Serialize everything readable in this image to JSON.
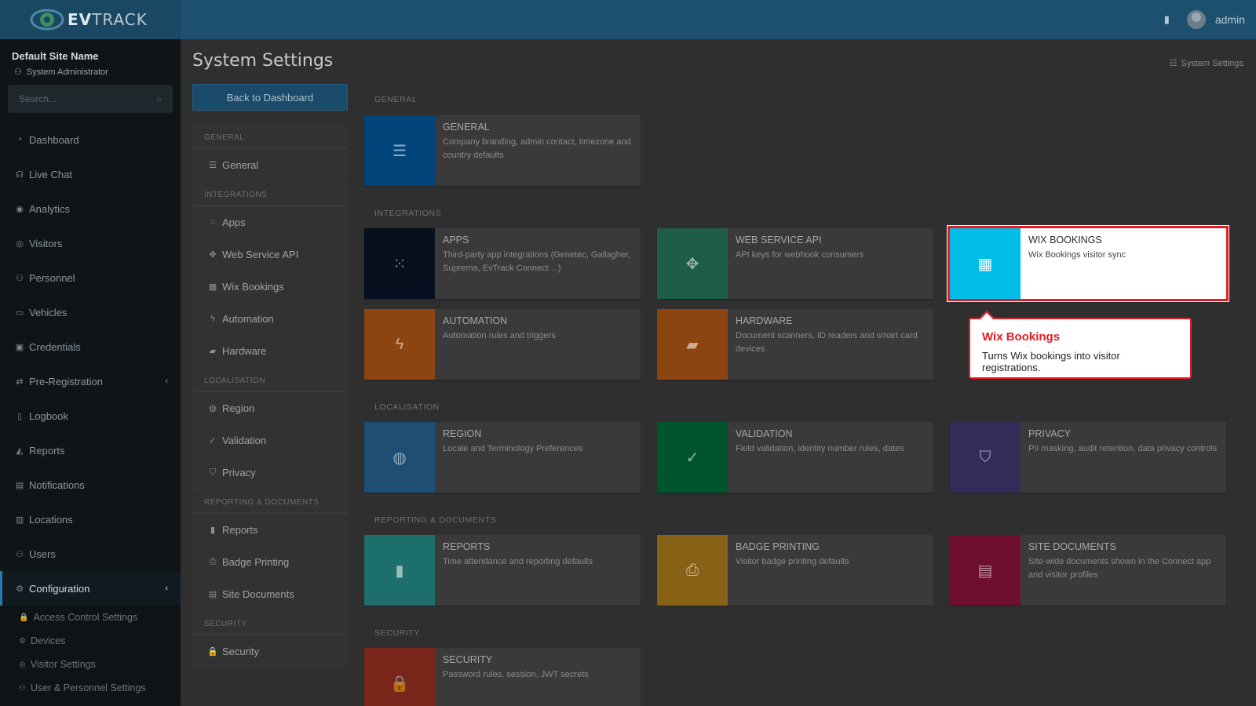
{
  "app": {
    "logo_bold": "EV",
    "logo_light": "TRACK",
    "user": "admin"
  },
  "sidebar": {
    "site_name": "Default Site Name",
    "role": "System Administrator",
    "search_placeholder": "Search...",
    "items": [
      {
        "label": "Dashboard",
        "icon": "dashboard-icon",
        "glyph": "◔"
      },
      {
        "label": "Live Chat",
        "icon": "headset-icon",
        "glyph": "☊"
      },
      {
        "label": "Analytics",
        "icon": "target-icon",
        "glyph": "◉"
      },
      {
        "label": "Visitors",
        "icon": "eye-icon",
        "glyph": "◎"
      },
      {
        "label": "Personnel",
        "icon": "users-icon",
        "glyph": "⚇"
      },
      {
        "label": "Vehicles",
        "icon": "car-icon",
        "glyph": "▭"
      },
      {
        "label": "Credentials",
        "icon": "id-card-icon",
        "glyph": "▣"
      },
      {
        "label": "Pre-Registration",
        "icon": "arrows-icon",
        "glyph": "⇄"
      },
      {
        "label": "Logbook",
        "icon": "book-icon",
        "glyph": "▯"
      },
      {
        "label": "Reports",
        "icon": "chart-icon",
        "glyph": "◭"
      },
      {
        "label": "Notifications",
        "icon": "chat-icon",
        "glyph": "▤"
      },
      {
        "label": "Locations",
        "icon": "map-icon",
        "glyph": "▥"
      },
      {
        "label": "Users",
        "icon": "user-group-icon",
        "glyph": "⚇"
      },
      {
        "label": "Configuration",
        "icon": "gear-icon",
        "glyph": "⚙"
      }
    ],
    "sub_items": [
      {
        "label": "Access Control Settings",
        "icon": "lock-icon",
        "glyph": "🔒"
      },
      {
        "label": "Devices",
        "icon": "gear-icon",
        "glyph": "⚙"
      },
      {
        "label": "Visitor Settings",
        "icon": "eye-icon",
        "glyph": "◎"
      },
      {
        "label": "User & Personnel Settings",
        "icon": "users-icon",
        "glyph": "⚇"
      }
    ]
  },
  "page": {
    "title": "System Settings",
    "breadcrumb": "System Settings",
    "back_label": "Back to Dashboard"
  },
  "left_menu": [
    {
      "group": "GENERAL",
      "items": [
        {
          "label": "General",
          "icon": "list-icon",
          "glyph": "☰"
        }
      ]
    },
    {
      "group": "INTEGRATIONS",
      "items": [
        {
          "label": "Apps",
          "icon": "grid-icon",
          "glyph": "⁙"
        },
        {
          "label": "Web Service API",
          "icon": "api-icon",
          "glyph": "✥"
        },
        {
          "label": "Wix Bookings",
          "icon": "calendar-icon",
          "glyph": "▦"
        },
        {
          "label": "Automation",
          "icon": "bolt-icon",
          "glyph": "ϟ"
        },
        {
          "label": "Hardware",
          "icon": "scanner-icon",
          "glyph": "▰"
        }
      ]
    },
    {
      "group": "LOCALISATION",
      "items": [
        {
          "label": "Region",
          "icon": "globe-icon",
          "glyph": "◍"
        },
        {
          "label": "Validation",
          "icon": "check-circle-icon",
          "glyph": "✓"
        },
        {
          "label": "Privacy",
          "icon": "shield-icon",
          "glyph": "⛉"
        }
      ]
    },
    {
      "group": "REPORTING & DOCUMENTS",
      "items": [
        {
          "label": "Reports",
          "icon": "bar-chart-icon",
          "glyph": "▮"
        },
        {
          "label": "Badge Printing",
          "icon": "printer-icon",
          "glyph": "⎙"
        },
        {
          "label": "Site Documents",
          "icon": "document-icon",
          "glyph": "▤"
        }
      ]
    },
    {
      "group": "SECURITY",
      "items": [
        {
          "label": "Security",
          "icon": "lock-icon",
          "glyph": "🔒"
        }
      ]
    }
  ],
  "sections": {
    "general": "GENERAL",
    "integrations": "INTEGRATIONS",
    "localisation": "LOCALISATION",
    "reporting": "REPORTING & DOCUMENTS",
    "security": "SECURITY"
  },
  "cards": {
    "general": {
      "title": "GENERAL",
      "desc": "Company branding, admin contact, timezone and country defaults",
      "color": "#02457a",
      "glyph": "☰"
    },
    "apps": {
      "title": "APPS",
      "desc": "Third-party app integrations (Genetec, Gallagher, Suprema, EvTrack Connect ...)",
      "color": "#07101f",
      "glyph": "⁙"
    },
    "webapi": {
      "title": "WEB SERVICE API",
      "desc": "API keys for webhook consumers",
      "color": "#1f5e46",
      "glyph": "✥"
    },
    "wix": {
      "title": "WIX BOOKINGS",
      "desc": "Wix Bookings visitor sync",
      "color": "#00bde8",
      "glyph": "▦"
    },
    "automation": {
      "title": "AUTOMATION",
      "desc": "Automation rules and triggers",
      "color": "#8c4510",
      "glyph": "ϟ"
    },
    "hardware": {
      "title": "HARDWARE",
      "desc": "Document scanners, ID readers and smart card devices",
      "color": "#8c4510",
      "glyph": "▰"
    },
    "region": {
      "title": "REGION",
      "desc": "Locale and Terminology Preferences",
      "color": "#1e4e74",
      "glyph": "◍"
    },
    "validation": {
      "title": "VALIDATION",
      "desc": "Field validation, identity number rules, dates",
      "color": "#00552d",
      "glyph": "✓"
    },
    "privacy": {
      "title": "PRIVACY",
      "desc": "PII masking, audit retention, data privacy controls",
      "color": "#332c59",
      "glyph": "⛉"
    },
    "reports": {
      "title": "REPORTS",
      "desc": "Time attendance and reporting defaults",
      "color": "#1c6f6b",
      "glyph": "▮"
    },
    "badge": {
      "title": "BADGE PRINTING",
      "desc": "Visitor badge printing defaults",
      "color": "#876115",
      "glyph": "⎙"
    },
    "sitedocs": {
      "title": "SITE DOCUMENTS",
      "desc": "Site-wide documents shown in the Connect app and visitor profiles",
      "color": "#6f0f2e",
      "glyph": "▤"
    },
    "security": {
      "title": "SECURITY",
      "desc": "Password rules, session, JWT secrets",
      "color": "#7a2519",
      "glyph": "🔒"
    }
  },
  "tooltip": {
    "title": "Wix Bookings",
    "body": "Turns Wix bookings into visitor registrations."
  }
}
